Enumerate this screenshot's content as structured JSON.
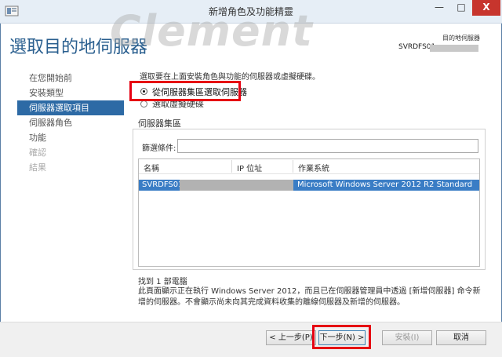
{
  "window": {
    "title": "新增角色及功能精靈",
    "minimize_glyph": "—",
    "maximize_glyph": "□",
    "close_glyph": "X"
  },
  "header": {
    "page_title": "選取目的地伺服器",
    "watermark": "Clement",
    "destination_label": "目的地伺服器",
    "destination_server": "SVRDFS01"
  },
  "nav": {
    "items": [
      {
        "label": "在您開始前"
      },
      {
        "label": "安裝類型"
      },
      {
        "label": "伺服器選取項目"
      },
      {
        "label": "伺服器角色"
      },
      {
        "label": "功能"
      },
      {
        "label": "確認"
      },
      {
        "label": "結果"
      }
    ]
  },
  "content": {
    "instruction": "選取要在上面安裝角色與功能的伺服器或虛擬硬碟。",
    "option_pool": "從伺服器集區選取伺服器",
    "option_vhd": "選取虛擬硬碟",
    "pool_title": "伺服器集區",
    "filter_label": "篩選條件:",
    "filter_value": "",
    "columns": [
      "名稱",
      "IP 位址",
      "作業系統"
    ],
    "rows": [
      {
        "name": "SVRDFS01.",
        "ip": "",
        "os": "Microsoft Windows Server 2012 R2 Standard"
      }
    ],
    "found": "找到 1 部電腦",
    "footnote": "此頁面顯示正在執行 Windows Server 2012，而且已在伺服器管理員中透過 [新增伺服器] 命令新增的伺服器。不會顯示尚未向其完成資料收集的離線伺服器及新增的伺服器。"
  },
  "buttons": {
    "prev": "< 上一步(P)",
    "next": "下一步(N) >",
    "install": "安裝(I)",
    "cancel": "取消"
  },
  "colors": {
    "accent": "#2d6aa5",
    "highlight": "#e60012",
    "selection": "#3a7dc5"
  }
}
